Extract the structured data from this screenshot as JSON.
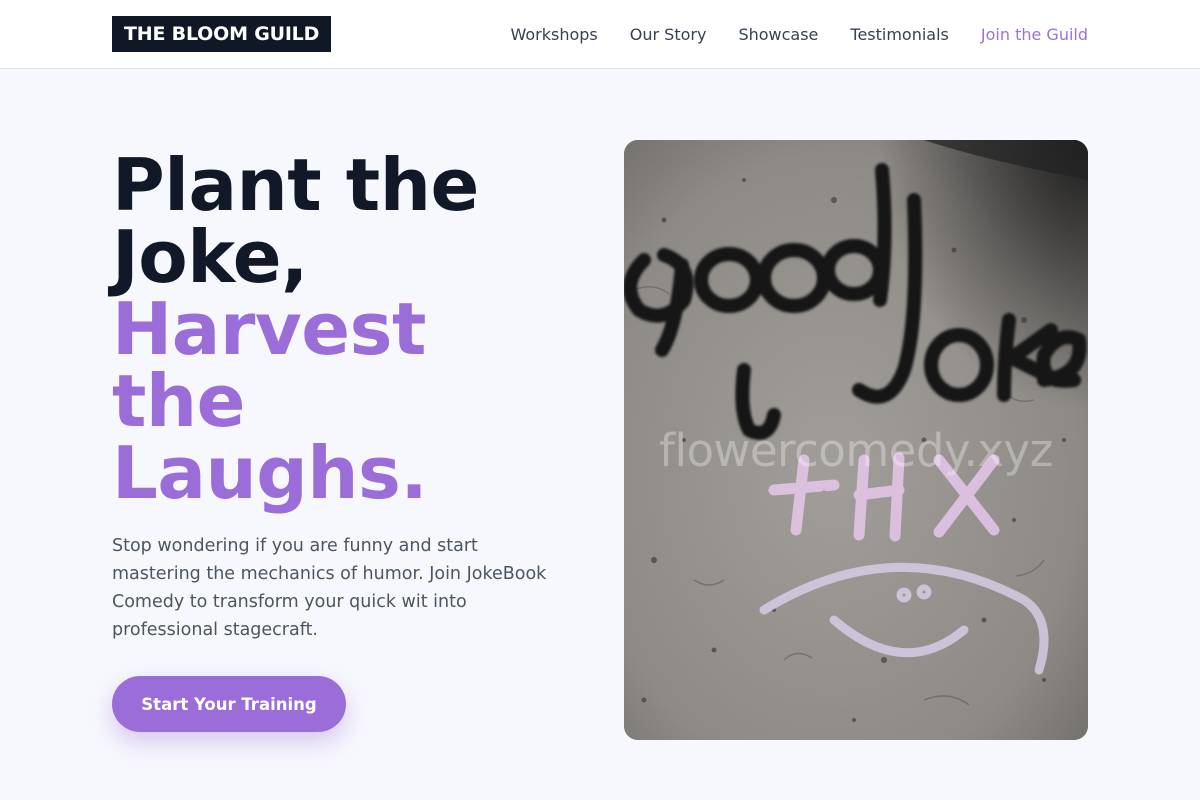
{
  "header": {
    "logo": "THE BLOOM GUILD",
    "nav": [
      {
        "label": "Workshops"
      },
      {
        "label": "Our Story"
      },
      {
        "label": "Showcase"
      },
      {
        "label": "Testimonials"
      },
      {
        "label": "Join the Guild",
        "accent": true
      }
    ]
  },
  "hero": {
    "title_lines": [
      "Plant the",
      "Joke,"
    ],
    "accent_lines": [
      "Harvest",
      "the",
      "Laughs."
    ],
    "description": "Stop wondering if you are funny and start mastering the mechanics of humor. Join JokeBook Comedy to transform your quick wit into professional stagecraft.",
    "cta_label": "Start Your Training",
    "image": {
      "subject": "graffiti-wall-photo",
      "graffiti_text": "good joke",
      "graffiti_text_2": "THX",
      "watermark": "flowercomedy.xyz"
    }
  },
  "colors": {
    "accent": "#9b6dd8",
    "logo_bg": "#101828",
    "page_bg": "#f7f8fd",
    "title": "#111827"
  }
}
